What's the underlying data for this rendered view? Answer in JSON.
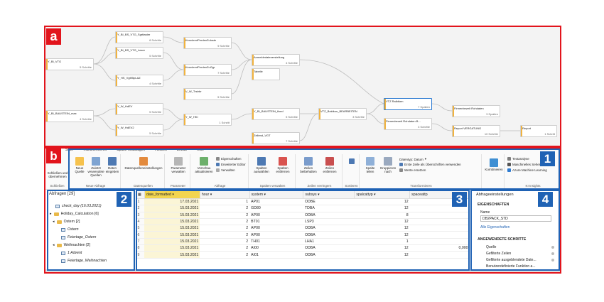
{
  "badges": {
    "a": "a",
    "b": "b",
    "n1": "1",
    "n2": "2",
    "n3": "3",
    "n4": "4"
  },
  "diagram": {
    "nodes": [
      {
        "name": "Y_BI_BS_VTG_Sgrttaster",
        "rows": "8 Schritte"
      },
      {
        "name": "Y_BI_BS_VTG_Leser",
        "rows": "5 Schritte"
      },
      {
        "name": "Y_BI_VTG",
        "rows": "5 Schritte"
      },
      {
        "name": "Y_HS_Vgt95pLAZ",
        "rows": "4 Schritte"
      },
      {
        "name": "KennlerntPerdenZuloste",
        "rows": "9 Schritte"
      },
      {
        "name": "KennlerntPerdenZuGgr",
        "rows": "7 Schritte"
      },
      {
        "name": "V_W_Trstrbr",
        "rows": "5 Schritte"
      },
      {
        "name": "Anmeldedatenerstellung",
        "rows": "4 Schritte"
      },
      {
        "name": "Tabelle",
        "rows": ""
      },
      {
        "name": "Y_BI_BAUSTEIN_max",
        "rows": "4 Schritte"
      },
      {
        "name": "Y_W_HdEV",
        "rows": "5 Schritte"
      },
      {
        "name": "Y_W_HdEV2",
        "rows": "5 Schritte"
      },
      {
        "name": "Y_W_HKI",
        "rows": "1 Schritt"
      },
      {
        "name": "Y_BI_BAUSTEIN_fixed",
        "rows": "5 Schritte"
      },
      {
        "name": "Zellend_VGT",
        "rows": "7 Schritte"
      },
      {
        "name": "VTZ_Bnktkon_BEARBEITEN",
        "rows": "3 Schritte"
      },
      {
        "name": "VTZ Ralbtken",
        "rows": "7 Spalten"
      },
      {
        "name": "Firmenbezeit Rohdaten",
        "rows": "3 Spalten"
      },
      {
        "name": "Firmenbezeit Rohdaten B...",
        "rows": "3 Schritte"
      },
      {
        "name": "Report VERGATUNG",
        "rows": "10 Schritte"
      },
      {
        "name": "Report",
        "rows": "1 Schritt"
      }
    ]
  },
  "ribbon": {
    "tabs": [
      "Start",
      "Transformieren",
      "Spalte hinzufügen",
      "Ansicht",
      "Extras",
      "Hilfe"
    ],
    "groups": [
      "Schließen",
      "Neue Abfrage",
      "Datenquellen",
      "Parameter",
      "Abfrage",
      "Spalten verwalten",
      "Zeilen verringern",
      "Sortieren",
      "Transformieren",
      "KI Insights"
    ],
    "buttons": {
      "close": "Schließen und übernehmen",
      "new_source": "Neue Quelle",
      "recent": "Zuletzt verwendete Quellen",
      "enter_data": "Daten eingeben",
      "ds_settings": "Datenquelleneinstellungen",
      "params": "Parameter verwalten",
      "preview": "Vorschau aktualisieren",
      "properties": "Eigenschaften",
      "advanced": "Erweiterter Editor",
      "manage": "Verwalten",
      "choose_cols": "Spalten auswählen",
      "remove_cols": "Spalten entfernen",
      "keep_rows": "Zeilen beibehalten",
      "remove_rows": "Zeilen entfernen",
      "split": "Spalte teilen",
      "group": "Gruppieren nach",
      "datatype": "Datentyp: Datum",
      "headers": "Erste Zeile als Überschriften verwenden",
      "replace": "Werte ersetzen",
      "combine": "Kombinieren",
      "text": "Textanalyse",
      "vision": "Maschinelles Sehen",
      "aml": "Azure Machine Learning"
    }
  },
  "queries": {
    "title": "Abfragen [29]",
    "items": [
      {
        "label": "check_day (16.03.2021)",
        "type": "table"
      },
      {
        "label": "Holiday_Calculation [6]",
        "type": "folder"
      },
      {
        "label": "Ostern [2]",
        "type": "folder"
      },
      {
        "label": "Ostern",
        "type": "table"
      },
      {
        "label": "Feiertage_Ostern",
        "type": "table"
      },
      {
        "label": "Weihnachten [2]",
        "type": "folder"
      },
      {
        "label": "1 Advent",
        "type": "table"
      },
      {
        "label": "Feiertage_Weihnachten",
        "type": "table"
      }
    ]
  },
  "grid": {
    "columns": [
      "date_formatted",
      "hour",
      "system",
      "subsys",
      "spalcattyp",
      "spaceattp"
    ],
    "rows": [
      [
        "1",
        "17.03.2021",
        "1",
        "AP01",
        "ODBE",
        "12",
        ""
      ],
      [
        "2",
        "15.03.2021",
        "2",
        "GD80",
        "TDBA",
        "12",
        ""
      ],
      [
        "3",
        "15.03.2021",
        "2",
        "AP00",
        "ODBA",
        "8",
        ""
      ],
      [
        "4",
        "15.03.2021",
        "2",
        "BT01",
        "LSP3",
        "12",
        ""
      ],
      [
        "5",
        "15.03.2021",
        "2",
        "AP00",
        "ODBA",
        "12",
        ""
      ],
      [
        "6",
        "15.03.2021",
        "2",
        "AP00",
        "ODBA",
        "12",
        ""
      ],
      [
        "7",
        "15.03.2021",
        "2",
        "TH01",
        "LHA1",
        "1",
        ""
      ],
      [
        "8",
        "15.03.2021",
        "2",
        "AI00",
        "ODBA",
        "12",
        "0,000"
      ],
      [
        "9",
        "15.03.2021",
        "2",
        "AI01",
        "ODBA",
        "12",
        ""
      ]
    ]
  },
  "settings": {
    "title": "Abfrageeinstellungen",
    "props_header": "EIGENSCHAFTEN",
    "name_label": "Name",
    "name_value": "DB2PACK_STD",
    "all_props": "Alle Eigenschaften",
    "steps_header": "ANGEWENDETE SCHRITTE",
    "steps": [
      "Quelle",
      "Gefilterte Zeilen",
      "Gefilterte ausgeblendete Date...",
      "Benutzerdefinierte Funktion a..."
    ]
  },
  "colors": {
    "frame": "#e2141c",
    "badge_blue": "#1f62b4",
    "selected_col": "#f2d54f"
  }
}
